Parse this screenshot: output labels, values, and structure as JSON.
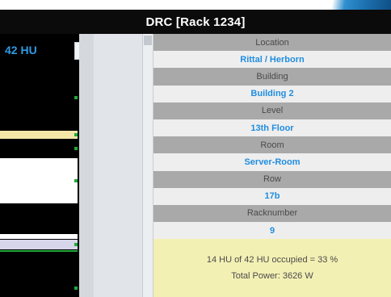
{
  "window": {
    "title": "DRC [Rack 1234]"
  },
  "rack": {
    "hu_label": "42 HU",
    "units": [
      {
        "color": "#000000"
      },
      {
        "color": "#f3e6a6"
      },
      {
        "color": "#000000"
      },
      {
        "color": "#ffffff"
      },
      {
        "color": "#000000"
      },
      {
        "color": "#ffffff"
      },
      {
        "color": "#d7d5e9"
      },
      {
        "color": "#000000"
      }
    ],
    "status_color": "#1faa3a",
    "accent_color": "#2f9be6"
  },
  "info": {
    "location_label": "Location",
    "location_value": "Rittal / Herborn",
    "building_label": "Building",
    "building_value": "Building 2",
    "level_label": "Level",
    "level_value": "13th Floor",
    "room_label": "Room",
    "room_value": "Server-Room",
    "row_label": "Row",
    "row_value": "17b",
    "racknumber_label": "Racknumber",
    "racknumber_value": "9"
  },
  "summary": {
    "occupancy_text": "14 HU of 42 HU occupied = 33 %",
    "power_text": "Total Power: 3626 W",
    "occupied_fraction": 0.33
  }
}
